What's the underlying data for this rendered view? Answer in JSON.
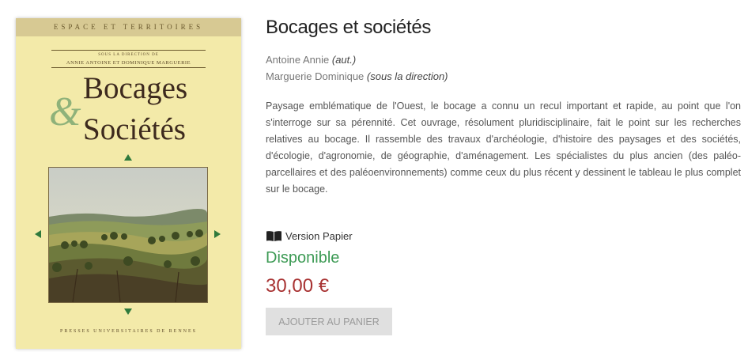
{
  "book": {
    "title": "Bocages et sociétés",
    "contributors": [
      {
        "name": "Antoine Annie",
        "role": "(aut.)"
      },
      {
        "name": "Marguerie Dominique",
        "role": "(sous la direction)"
      }
    ],
    "description": "Paysage emblématique de l'Ouest, le bocage a connu un recul important et rapide, au point que l'on s'interroge sur sa pérennité. Cet ouvrage, résolument pluridisciplinaire, fait le point sur les recherches relatives au bocage. Il rassemble des travaux d'archéologie, d'histoire des paysages et des sociétés, d'écologie, d'agronomie, de géographie, d'aménagement. Les spécialistes du plus ancien (des paléo-parcellaires et des paléoenvironnements) comme ceux du plus récent y dessinent le tableau le plus complet sur le bocage."
  },
  "cover": {
    "series": "Espace et territoires",
    "direction_label": "Sous la direction de",
    "direction_names": "Annie Antoine et Dominique Marguerie",
    "title_line1": "Bocages",
    "ampersand": "&",
    "title_line2": "Sociétés",
    "publisher": "Presses universitaires de Rennes"
  },
  "purchase": {
    "version_label": "Version Papier",
    "version_icon": "open-book-icon",
    "availability": "Disponible",
    "price": "30,00 €",
    "add_to_cart_label": "Ajouter au panier"
  },
  "colors": {
    "availability": "#3c9a54",
    "price": "#a83232",
    "cover_background": "#f3eaa9"
  }
}
